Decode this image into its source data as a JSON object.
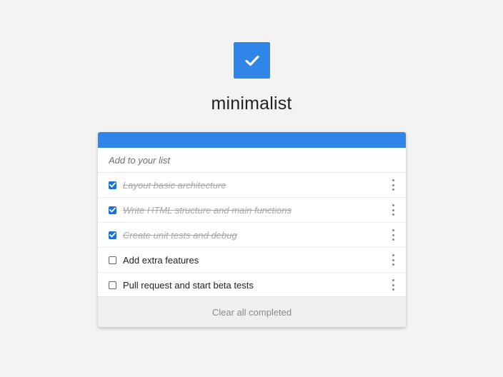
{
  "app": {
    "title": "minimalist",
    "logo_icon": "check-icon",
    "accent_color": "#2f86e8"
  },
  "input": {
    "placeholder": "Add to your list",
    "value": ""
  },
  "items": [
    {
      "label": "Layout basic architecture",
      "completed": true
    },
    {
      "label": "Write HTML structure and main functions",
      "completed": true
    },
    {
      "label": "Create unit tests and debug",
      "completed": true
    },
    {
      "label": "Add extra features",
      "completed": false
    },
    {
      "label": "Pull request and start beta tests",
      "completed": false
    }
  ],
  "footer": {
    "clear_label": "Clear all completed"
  }
}
